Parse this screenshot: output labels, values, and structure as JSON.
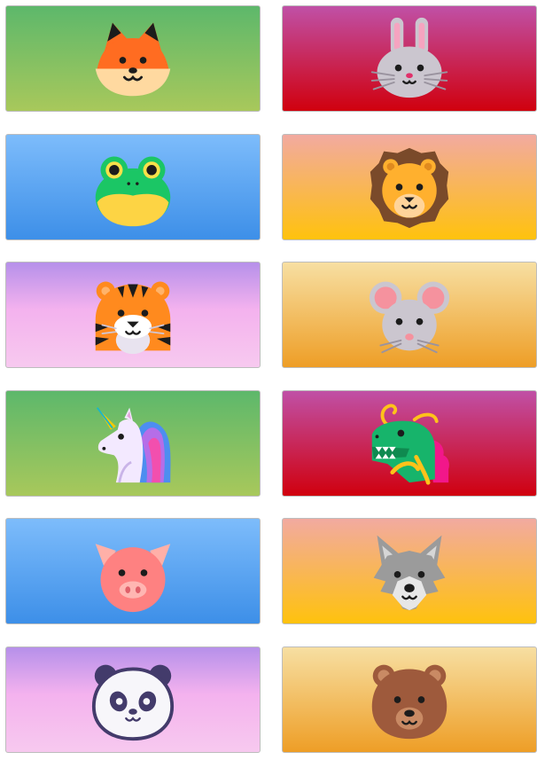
{
  "cards": [
    {
      "animal": "fox",
      "icon": "fox-icon"
    },
    {
      "animal": "rabbit",
      "icon": "rabbit-icon"
    },
    {
      "animal": "frog",
      "icon": "frog-icon"
    },
    {
      "animal": "lion",
      "icon": "lion-icon"
    },
    {
      "animal": "tiger",
      "icon": "tiger-icon"
    },
    {
      "animal": "mouse",
      "icon": "mouse-icon"
    },
    {
      "animal": "unicorn",
      "icon": "unicorn-icon"
    },
    {
      "animal": "dragon",
      "icon": "dragon-icon"
    },
    {
      "animal": "pig",
      "icon": "pig-icon"
    },
    {
      "animal": "wolf",
      "icon": "wolf-icon"
    },
    {
      "animal": "panda",
      "icon": "panda-icon"
    },
    {
      "animal": "bear",
      "icon": "bear-icon"
    }
  ],
  "colors": {
    "green": [
      "#5db86b",
      "#a8c85b"
    ],
    "red": [
      "#c050a6",
      "#d0000e"
    ],
    "blue": [
      "#7dbcfb",
      "#3d8fe8"
    ],
    "orange": [
      "#f2aaa0",
      "#ffc20d"
    ],
    "purple": [
      "#b690ea",
      "#f7c9ef"
    ],
    "gold": [
      "#f7dfa2",
      "#ee9e26"
    ]
  }
}
